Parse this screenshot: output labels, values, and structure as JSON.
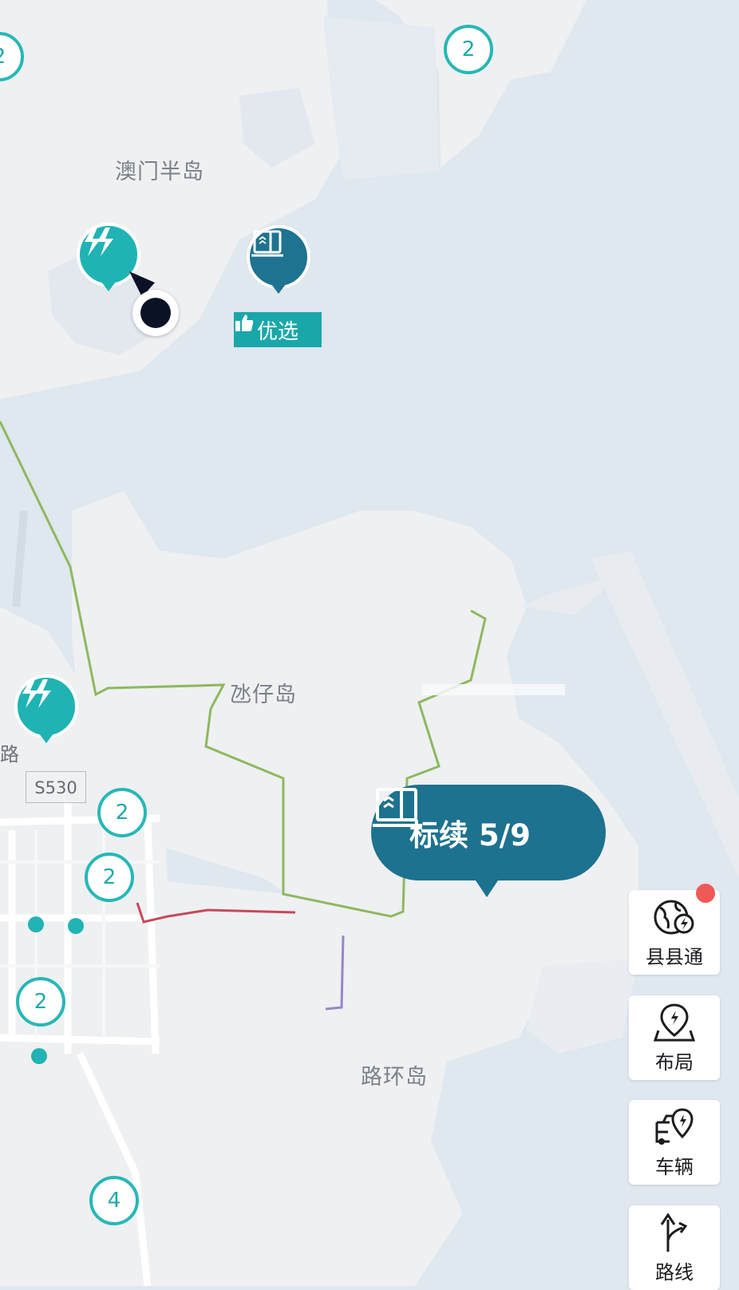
{
  "map": {
    "place_labels": [
      "澳门半岛",
      "氹仔岛",
      "路环岛"
    ],
    "road_label": "路",
    "road_shield": "S530",
    "clusters": [
      "2",
      "2",
      "2",
      "2",
      "2",
      "4",
      "2"
    ]
  },
  "markers": {
    "featured_badge": "优选",
    "selected_store_label": "标续 5/9"
  },
  "side_buttons": [
    "县县通",
    "布局",
    "车辆",
    "路线"
  ],
  "colors": {
    "teal": "#1fb3b4",
    "store_blue": "#1d728f",
    "green_route": "#8fb85f",
    "red_route": "#c6495a",
    "purple_route": "#9a84c9",
    "notification": "#f05a55"
  },
  "icons": [
    "charging-station-icon",
    "store-icon",
    "thumbs-up-icon",
    "globe-charge-icon",
    "location-pin-icon",
    "vehicle-icon",
    "route-icon"
  ]
}
